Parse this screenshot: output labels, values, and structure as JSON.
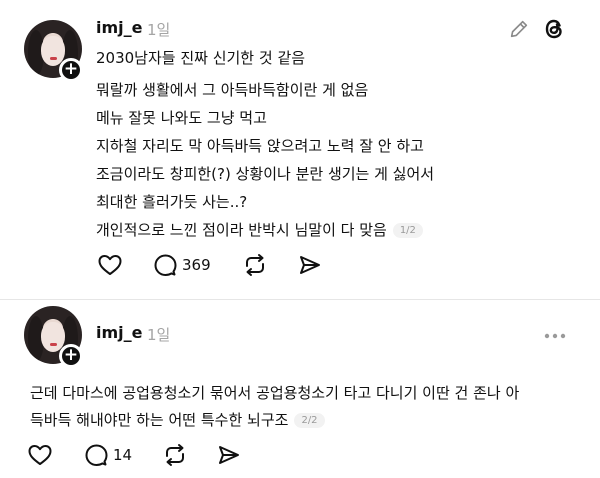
{
  "post1": {
    "username": "imj_e",
    "time": "1일",
    "lines": [
      "2030남자들 진짜 신기한 것 같음",
      "뭐랄까 생활에서 그 아득바득함이란 게 없음",
      "메뉴 잘못 나와도 그냥 먹고",
      "지하철 자리도 막 아득바득 앉으려고 노력 잘 안 하고",
      "조금이라도 창피한(?) 상황이나 분란 생기는 게 싫어서",
      "최대한 흘러가듯 사는..?",
      "개인적으로 느낀 점이라 반박시 님말이 다 맞음"
    ],
    "page": "1/2",
    "reply_count": "369"
  },
  "post2": {
    "username": "imj_e",
    "time": "1일",
    "lines": [
      "근데 다마스에 공업용청소기 묶어서 공업용청소기 타고 다니기 이딴 건 존나 아",
      "득바득 해내야만 하는 어떤 특수한 뇌구조"
    ],
    "page": "2/2",
    "reply_count": "14"
  },
  "icons": {
    "like": "heart-icon",
    "reply": "comment-icon",
    "repost": "repost-icon",
    "share": "send-icon",
    "edit": "pencil-icon",
    "threads": "threads-logo-icon",
    "more": "more-icon"
  }
}
